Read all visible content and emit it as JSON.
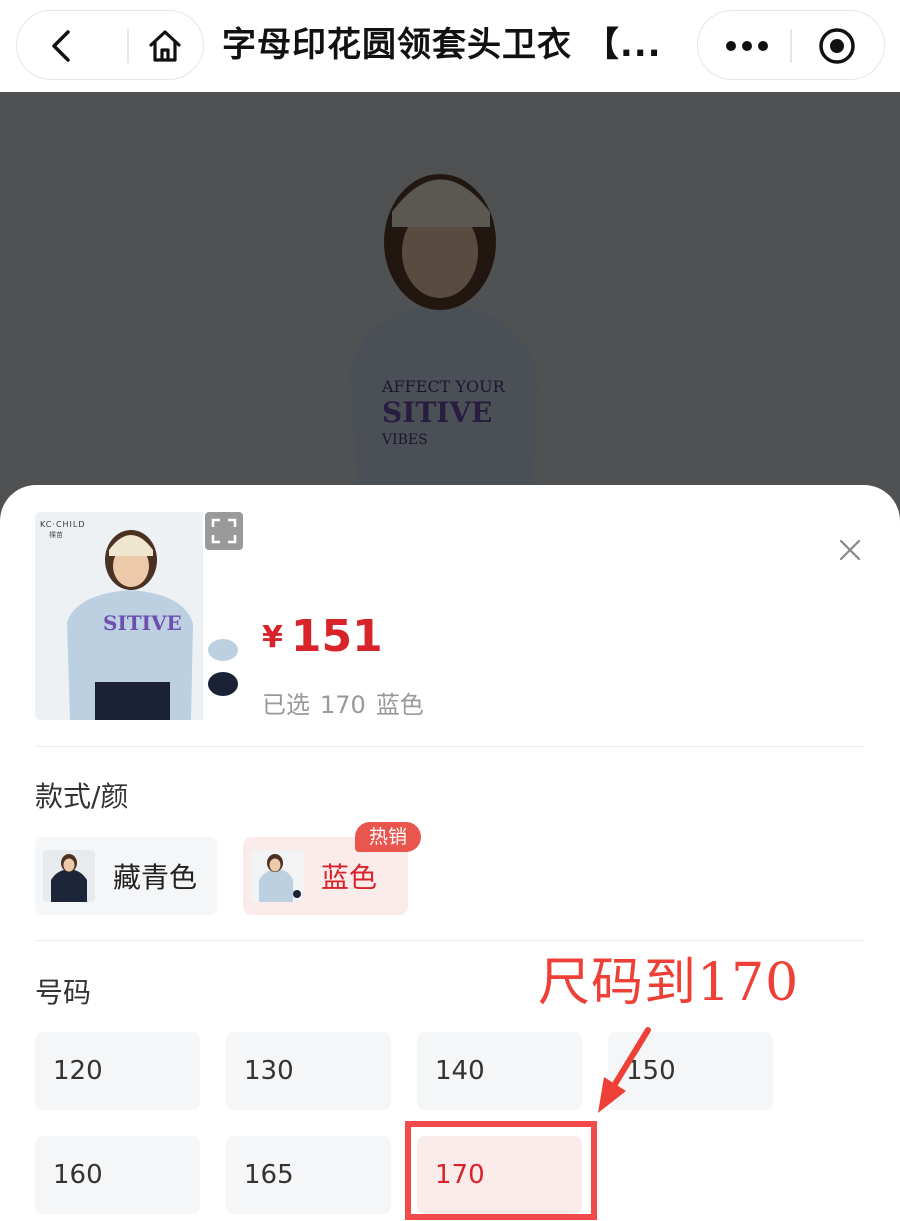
{
  "window": {
    "title": "字母印花圆领套头卫衣 【..."
  },
  "product_panel": {
    "thumbnail": {
      "brand": "KC·CHILD",
      "brand_sub": "棵苗"
    },
    "price_symbol": "¥",
    "price": "151",
    "selected_prefix": "已选",
    "selected_size": "170",
    "selected_color": "蓝色"
  },
  "color_section": {
    "label": "款式/颜",
    "options": [
      {
        "label": "藏青色",
        "state": "normal"
      },
      {
        "label": "蓝色",
        "state": "selected",
        "badge": "热销"
      }
    ]
  },
  "size_section": {
    "label": "号码",
    "options": [
      {
        "label": "120",
        "state": "normal"
      },
      {
        "label": "130",
        "state": "normal"
      },
      {
        "label": "140",
        "state": "normal"
      },
      {
        "label": "150",
        "state": "normal"
      },
      {
        "label": "160",
        "state": "normal"
      },
      {
        "label": "165",
        "state": "normal"
      },
      {
        "label": "170",
        "state": "selected"
      }
    ]
  },
  "annotation": {
    "text": "尺码到170",
    "color": "#ee4036"
  },
  "colors": {
    "accent_red": "#d9232b",
    "selected_bg": "#fbeceb",
    "option_bg": "#f5f6f8",
    "badge": "#e9564d"
  },
  "icons": [
    "back-icon",
    "home-icon",
    "more-icon",
    "target-icon",
    "expand-icon",
    "close-icon"
  ]
}
